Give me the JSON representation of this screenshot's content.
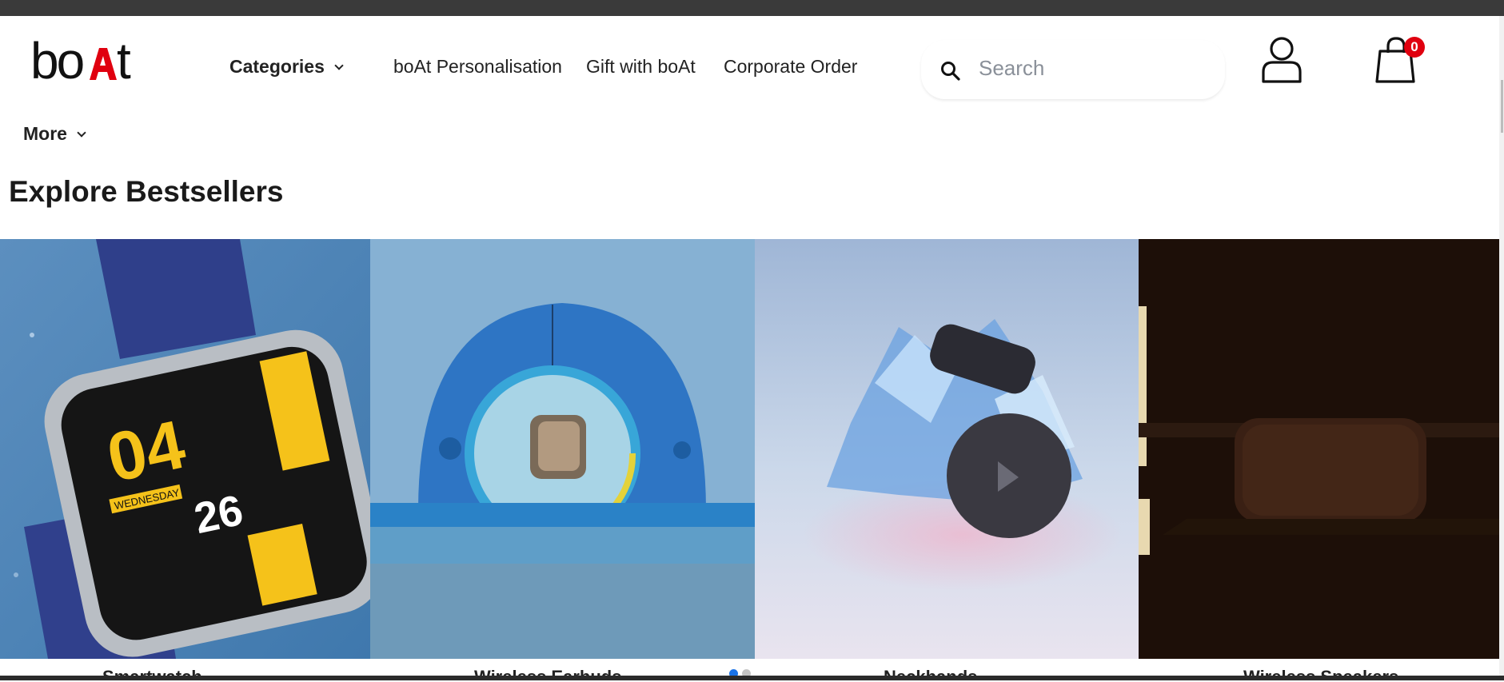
{
  "header": {
    "logo_text": "boAt",
    "nav": {
      "categories": "Categories",
      "personalisation": "boAt Personalisation",
      "gift": "Gift with boAt",
      "corporate": "Corporate Order",
      "more": "More"
    },
    "search": {
      "placeholder": "Search"
    },
    "cart": {
      "count": "0"
    },
    "icons": {
      "search": "search-icon",
      "user": "user-icon",
      "cart": "shopping-bag-icon",
      "chevron": "chevron-down-icon"
    }
  },
  "section": {
    "title_light": "Explore",
    "title_bold": "Bestsellers"
  },
  "carousel": {
    "cards": [
      {
        "label": "Smartwatch",
        "watch_face_hour": "04",
        "watch_face_min": "26",
        "watch_face_day": "WEDNESDAY"
      },
      {
        "label": "Wireless Earbuds"
      },
      {
        "label": "Neckbands"
      },
      {
        "label": "Wireless Speakers"
      }
    ],
    "dots": {
      "active_color": "#1a73e8",
      "inactive_color": "#c4c4c4"
    }
  },
  "colors": {
    "brand_red": "#e0000f",
    "topbar": "#3a3a3a"
  }
}
